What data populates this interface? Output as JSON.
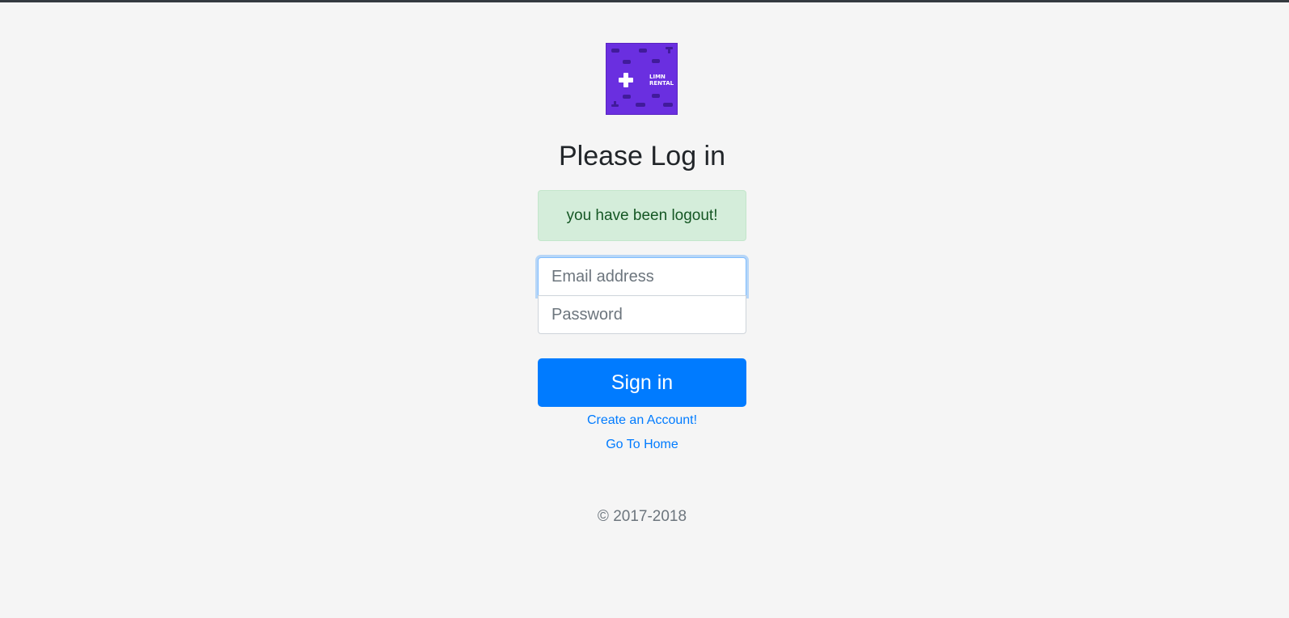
{
  "logo": {
    "text_line1": "LIMN",
    "text_line2": "RENTAL",
    "background": "#6a2fe0"
  },
  "page_title": "Please Log in",
  "alert": {
    "message": "you have been logout!"
  },
  "form": {
    "email_placeholder": "Email address",
    "email_value": "",
    "password_placeholder": "Password",
    "password_value": "",
    "submit_label": "Sign in"
  },
  "links": {
    "create_account": "Create an Account!",
    "go_home": "Go To Home"
  },
  "footer": {
    "copyright": "© 2017-2018"
  },
  "colors": {
    "primary": "#007bff",
    "alert_bg": "#d4edda",
    "alert_text": "#155724",
    "page_bg": "#f5f5f5"
  }
}
